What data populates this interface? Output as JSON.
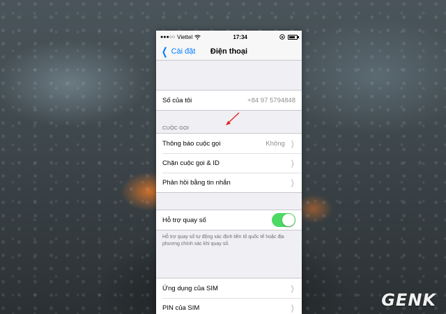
{
  "status_bar": {
    "carrier": "Viettel",
    "time": "17:34"
  },
  "nav": {
    "back_label": "Cài đặt",
    "title": "Điện thoại"
  },
  "my_number": {
    "label": "Số của tôi",
    "value": "+84 97 5794848"
  },
  "calls_section": {
    "header": "CUỘC GỌI",
    "items": [
      {
        "label": "Thông báo cuộc gọi",
        "value": "Không"
      },
      {
        "label": "Chặn cuộc gọi & ID",
        "value": ""
      },
      {
        "label": "Phản hồi bằng tin nhắn",
        "value": ""
      }
    ]
  },
  "dial_assist": {
    "label": "Hỗ trợ quay số",
    "enabled": true,
    "footer": "Hỗ trợ quay số tự động xác định tiền tố quốc tế hoặc địa phương chính xác khi quay số."
  },
  "sim_section": {
    "items": [
      {
        "label": "Ứng dụng của SIM"
      },
      {
        "label": "PIN của SIM"
      }
    ]
  },
  "colors": {
    "accent": "#007aff",
    "toggle_on": "#4cd964",
    "annotation_arrow": "#e0201b"
  },
  "watermark": "GENK"
}
